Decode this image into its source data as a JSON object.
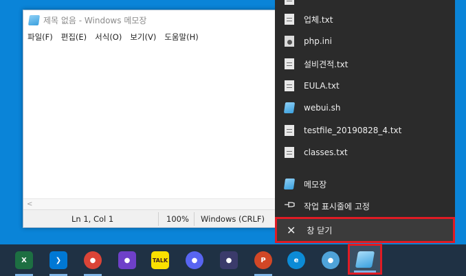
{
  "notepad": {
    "title": "제목 없음 - Windows 메모장",
    "menu": [
      "파일(F)",
      "편집(E)",
      "서식(O)",
      "보기(V)",
      "도움말(H)"
    ],
    "scroll_left_glyph": "<",
    "status": {
      "position": "Ln 1, Col 1",
      "zoom": "100%",
      "line_ending": "Windows (CRLF)"
    }
  },
  "jumplist": {
    "items": [
      {
        "label": "업체.txt",
        "icon": "text-file-icon"
      },
      {
        "label": "php.ini",
        "icon": "ini-file-icon"
      },
      {
        "label": "설비견적.txt",
        "icon": "text-file-icon"
      },
      {
        "label": "EULA.txt",
        "icon": "text-file-icon"
      },
      {
        "label": "webui.sh",
        "icon": "notepad-file-icon"
      },
      {
        "label": "testfile_20190828_4.txt",
        "icon": "text-file-icon"
      },
      {
        "label": "classes.txt",
        "icon": "text-file-icon"
      }
    ],
    "app_label": "메모장",
    "pin_label": "작업 표시줄에 고정",
    "close_label": "창 닫기",
    "close_glyph": "✕"
  },
  "taskbar": {
    "apps": [
      {
        "name": "excel-icon",
        "glyph": "X",
        "color": "#1d6f42"
      },
      {
        "name": "vscode-icon",
        "glyph": "❯",
        "color": "#0078d4"
      },
      {
        "name": "chrome-icon",
        "glyph": "●",
        "color": "#db4437"
      },
      {
        "name": "github-icon",
        "glyph": "●",
        "color": "#6e40c9"
      },
      {
        "name": "kakaotalk-icon",
        "glyph": "TALK",
        "color": "#f9e000"
      },
      {
        "name": "discord-icon",
        "glyph": "●",
        "color": "#5865f2"
      },
      {
        "name": "davinci-icon",
        "glyph": "●",
        "color": "#3b3b6b"
      },
      {
        "name": "powerpoint-icon",
        "glyph": "P",
        "color": "#d24726"
      },
      {
        "name": "edge-icon",
        "glyph": "e",
        "color": "#0c8bd6"
      },
      {
        "name": "bot-icon",
        "glyph": "●",
        "color": "#4fa3d9"
      },
      {
        "name": "notepad-icon",
        "glyph": "",
        "color": "#55aee8"
      }
    ]
  }
}
